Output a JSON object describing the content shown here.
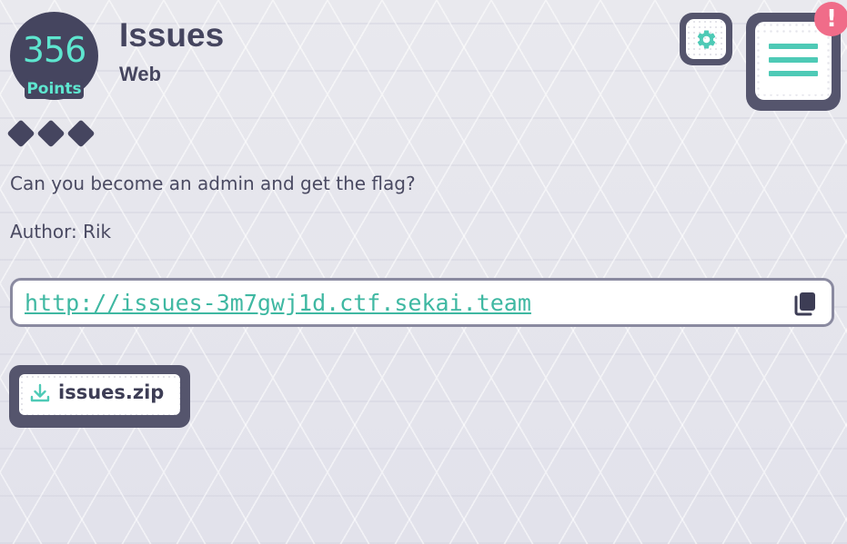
{
  "challenge": {
    "points_value": "356",
    "points_label": "Points",
    "title": "Issues",
    "category": "Web",
    "difficulty_level": 3,
    "description": "Can you become an admin and get the flag?",
    "author": "Author: Rik",
    "url": "http://issues-3m7gwj1d.ctf.sekai.team",
    "attachment_name": "issues.zip"
  },
  "header_actions": {
    "settings_icon": "gear-icon",
    "menu_icon": "hamburger-menu-icon",
    "alert_badge": "!"
  },
  "colors": {
    "accent": "#5ee6cf",
    "link": "#3fb8a2",
    "dark": "#45455f",
    "alert": "#f06c89"
  },
  "icons": {
    "copy": "copy-icon",
    "download": "download-icon"
  }
}
